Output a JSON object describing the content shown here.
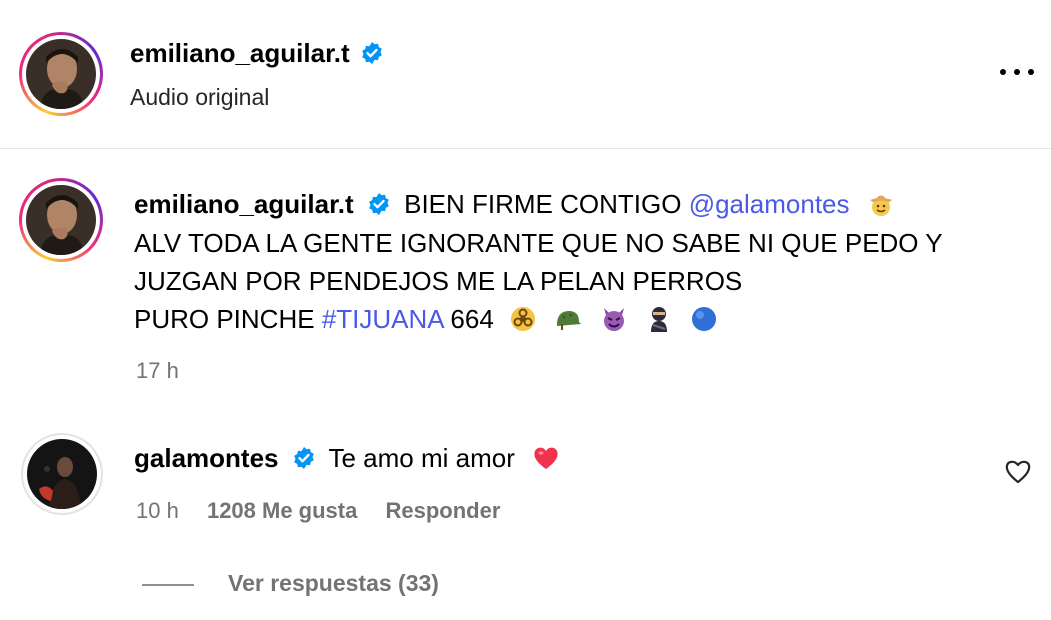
{
  "post_header": {
    "username": "emiliano_aguilar.t",
    "subtitle": "Audio original",
    "verified_icon": "verified-badge-icon",
    "more_icon": "more-options-icon"
  },
  "caption": {
    "username": "emiliano_aguilar.t",
    "line1_text": "BIEN FIRME CONTIGO",
    "line1_mention": "@galamontes",
    "line2": "ALV TODA LA GENTE IGNORANTE QUE NO SABE NI QUE PEDO Y",
    "line3": "JUZGAN POR PENDEJOS ME LA PELAN PERROS",
    "line4_text": "PURO PINCHE",
    "line4_hashtag": "#TIJUANA",
    "line4_number": "664",
    "time": "17 h",
    "emojis": [
      "cowboy-face",
      "biohazard",
      "military-helmet",
      "smiling-devil",
      "ninja",
      "blue-circle"
    ]
  },
  "reply_comment": {
    "username": "galamontes",
    "text": "Te amo mi amor",
    "time": "10 h",
    "likes": "1208 Me gusta",
    "reply_label": "Responder",
    "view_replies": "Ver respuestas (33)"
  },
  "colors": {
    "link_blue": "#4a5ae8",
    "verified_blue": "#0095f6",
    "meta_gray": "#737373",
    "heart_red": "#f0324f"
  }
}
